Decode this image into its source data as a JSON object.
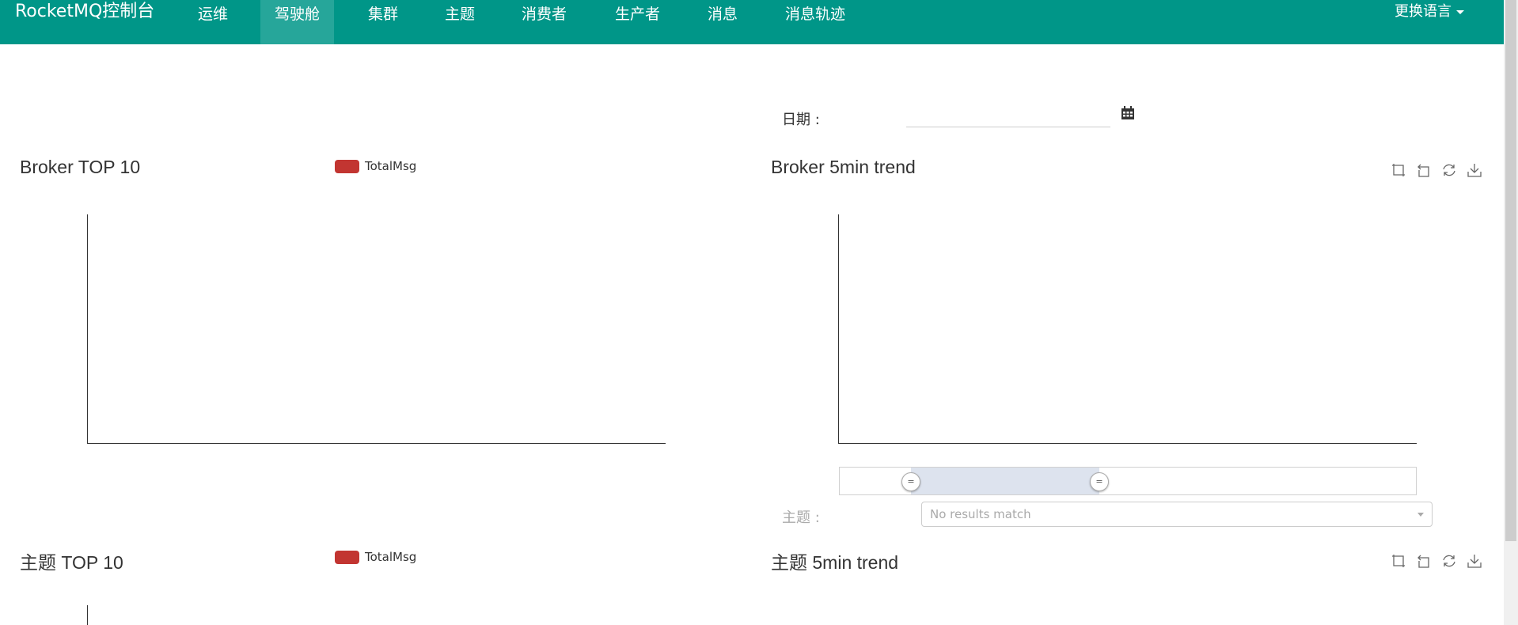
{
  "navbar": {
    "brand": "RocketMQ控制台",
    "items": [
      {
        "label": "运维"
      },
      {
        "label": "驾驶舱"
      },
      {
        "label": "集群"
      },
      {
        "label": "主题"
      },
      {
        "label": "消费者"
      },
      {
        "label": "生产者"
      },
      {
        "label": "消息"
      },
      {
        "label": "消息轨迹"
      }
    ],
    "active_index": 1,
    "language_label": "更换语言"
  },
  "date": {
    "label": "日期 :",
    "value": ""
  },
  "broker_top10": {
    "title": "Broker TOP 10",
    "legend": "TotalMsg",
    "legend_color": "#c23531"
  },
  "broker_trend": {
    "title": "Broker 5min trend"
  },
  "topic_filter": {
    "label": "主题 :",
    "placeholder": "No results match"
  },
  "topic_top10": {
    "title": "主题 TOP 10",
    "legend": "TotalMsg",
    "legend_color": "#c23531"
  },
  "topic_trend": {
    "title": "主题 5min trend"
  },
  "toolbox_icons": [
    "zoom-icon",
    "zoom-reset-icon",
    "restore-icon",
    "download-icon"
  ],
  "colors": {
    "navbar": "#009688",
    "navbar_active": "#26a69a",
    "series": "#c23531"
  },
  "chart_data": [
    {
      "type": "bar",
      "title": "Broker TOP 10",
      "legend": [
        "TotalMsg"
      ],
      "categories": [],
      "series": [
        {
          "name": "TotalMsg",
          "values": []
        }
      ]
    },
    {
      "type": "line",
      "title": "Broker 5min trend",
      "x": [],
      "series": []
    },
    {
      "type": "bar",
      "title": "主题 TOP 10",
      "legend": [
        "TotalMsg"
      ],
      "categories": [],
      "series": [
        {
          "name": "TotalMsg",
          "values": []
        }
      ]
    },
    {
      "type": "line",
      "title": "主题 5min trend",
      "x": [],
      "series": []
    }
  ]
}
